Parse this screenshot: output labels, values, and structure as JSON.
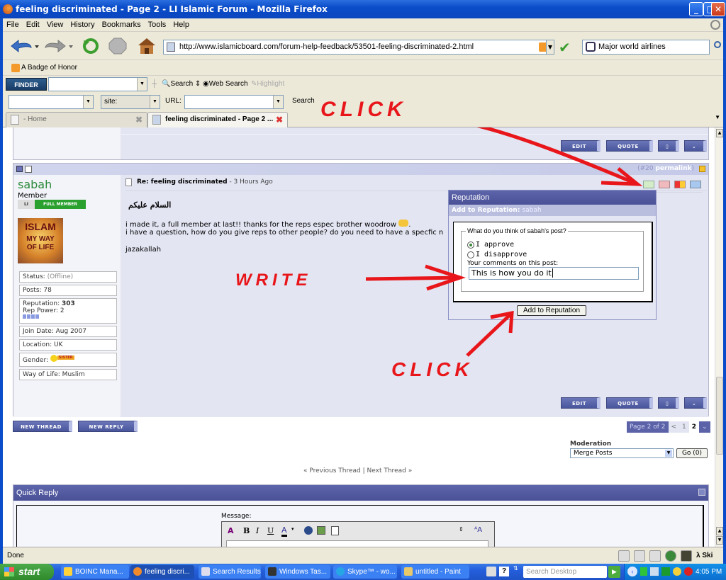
{
  "window": {
    "title": "feeling discriminated - Page 2 - LI Islamic Forum - Mozilla Firefox",
    "controls": [
      "minimize",
      "maximize",
      "close"
    ]
  },
  "menu": [
    "File",
    "Edit",
    "View",
    "History",
    "Bookmarks",
    "Tools",
    "Help"
  ],
  "nav": {
    "url": "http://www.islamicboard.com/forum-help-feedback/53501-feeling-discriminated-2.html",
    "search_value": "Major world airlines"
  },
  "bookmarks": [
    {
      "label": "A Badge of Honor"
    }
  ],
  "finder_toolbar": {
    "logo": "FINDER",
    "search_label": "Search",
    "web_search_label": "Web Search",
    "highlight_label": "Highlight",
    "site_label": "site:",
    "url_label": "URL:",
    "search_button": "Search"
  },
  "tabs": [
    {
      "label": "- Home",
      "active": false
    },
    {
      "label": "feeling discriminated - Page 2 ...",
      "active": true
    }
  ],
  "post_buttons": {
    "edit": "EDIT",
    "quote": "QUOTE"
  },
  "post": {
    "number": "(#20",
    "permalink": "permalink",
    "close_paren": ")",
    "username": "sabah",
    "rank": "Member",
    "badge_left": "LI",
    "badge_right": "FULL MEMBER",
    "avatar_lines": [
      "ISLAM",
      "MY WAY",
      "OF LIFE"
    ],
    "title": "Re: feeling discriminated",
    "time": " - 3 Hours Ago",
    "arabic": "السلام عليكم",
    "line1": "i made it, a full member at last!! thanks for the reps espec brother woodrow",
    "line1_end": ".",
    "line2": "i have a question, how do you give reps to other people? do you need to have a specfic n",
    "signoff": "jazakallah",
    "info": {
      "status_label": "Status:",
      "status_value": "(Offline)",
      "posts": "Posts: 78",
      "reputation_label": "Reputation:",
      "reputation_value": "303",
      "rep_power": "Rep Power: 2",
      "join_date": "Join Date: Aug 2007",
      "location": "Location: UK",
      "gender_label": "Gender:",
      "gender_badge": "SISTER",
      "way_of_life": "Way of Life: Muslim"
    }
  },
  "reputation_popup": {
    "title": "Reputation",
    "subtitle_label": "Add to Reputation:",
    "subtitle_user": "sabah",
    "legend": "What do you think of sabah's post?",
    "approve": "I approve",
    "disapprove": "I disapprove",
    "selected": "approve",
    "comment_label": "Your comments on this post:",
    "comment_value": "This is how you do it",
    "submit": "Add to Reputation"
  },
  "annotations": {
    "click_top": "CLICK",
    "write": "WRITE",
    "click_bottom": "CLICK"
  },
  "thread_buttons": {
    "new_thread": "NEW THREAD",
    "new_reply": "NEW REPLY"
  },
  "pagination": {
    "label": "Page 2 of 2",
    "prev": "<",
    "pages": [
      "1",
      "2"
    ],
    "current": "2"
  },
  "moderation": {
    "label": "Moderation",
    "selected": "Merge Posts",
    "go": "Go (0)"
  },
  "thread_nav": {
    "prev": "« Previous Thread",
    "sep": "|",
    "next": "Next Thread »"
  },
  "quick_reply": {
    "title": "Quick Reply",
    "message_label": "Message:"
  },
  "status": {
    "text": "Done",
    "right_text": "λ Ski"
  },
  "taskbar": {
    "start": "start",
    "tasks": [
      {
        "label": "BOINC Mana...",
        "active": false
      },
      {
        "label": "feeling discri...",
        "active": true
      },
      {
        "label": "Search Results",
        "active": false
      },
      {
        "label": "Windows Tas...",
        "active": false
      },
      {
        "label": "Skype™ - wo...",
        "active": false
      },
      {
        "label": "untitled - Paint",
        "active": false
      }
    ],
    "desktop_search_placeholder": "Search Desktop",
    "clock": "4:05 PM"
  }
}
